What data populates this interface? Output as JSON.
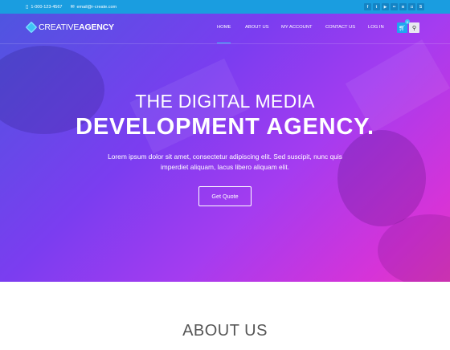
{
  "topbar": {
    "phone": "1-000-123-4567",
    "email": "email@r-create.com",
    "social": [
      "facebook-icon",
      "twitter-icon",
      "youtube-icon",
      "flickr-icon",
      "rss-icon",
      "instagram-icon",
      "skype-icon"
    ],
    "social_glyphs": [
      "f",
      "t",
      "▶",
      "••",
      "≋",
      "◘",
      "S"
    ]
  },
  "header": {
    "logo_part1": "CREATIVE",
    "logo_part2": "AGENCY",
    "nav": [
      {
        "label": "HOME",
        "active": true
      },
      {
        "label": "ABOUT US",
        "active": false
      },
      {
        "label": "MY ACCOUNT",
        "active": false
      },
      {
        "label": "CONTACT US",
        "active": false
      },
      {
        "label": "LOG IN",
        "active": false
      }
    ],
    "cart_count": "0"
  },
  "hero": {
    "title1": "THE DIGITAL MEDIA",
    "title2": "DEVELOPMENT AGENCY.",
    "description": "Lorem ipsum dolor sit amet, consectetur adipiscing elit. Sed suscipit, nunc quis imperdiet aliquam, lacus libero aliquam elit.",
    "cta_label": "Get Quote"
  },
  "about": {
    "title": "ABOUT US"
  },
  "colors": {
    "topbar": "#1a9de0",
    "accent": "#3ec3f5",
    "gradient_start": "#4f55e0",
    "gradient_end": "#e43bc0"
  }
}
